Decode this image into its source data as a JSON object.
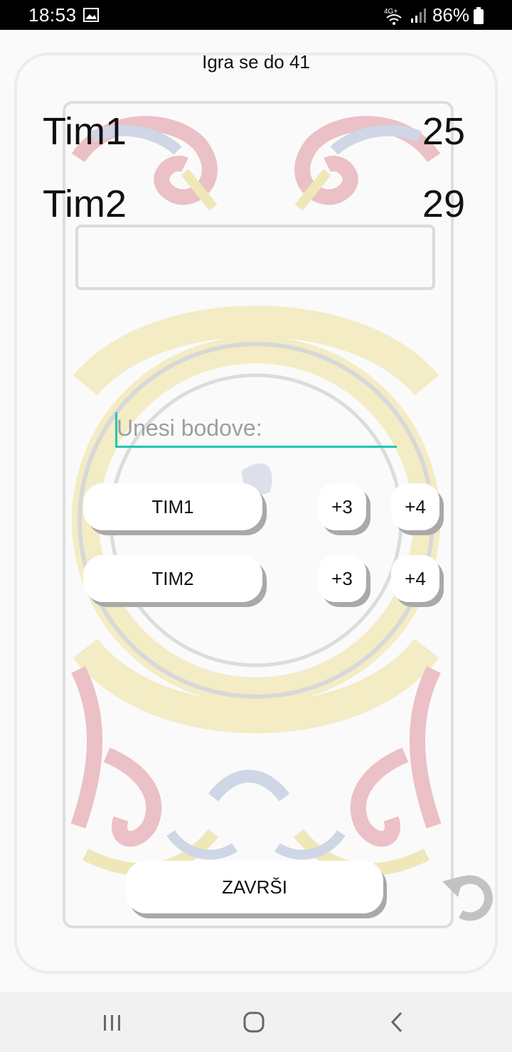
{
  "status_bar": {
    "time": "18:53",
    "network": "4G+",
    "battery": "86%",
    "icons": [
      "image-icon",
      "wifi-icon",
      "signal-icon",
      "battery-icon"
    ]
  },
  "game": {
    "goal_text": "Igra se do 41"
  },
  "teams": [
    {
      "name": "Tim1",
      "score": "25"
    },
    {
      "name": "Tim2",
      "score": "29"
    }
  ],
  "input": {
    "placeholder": "Unesi bodove:",
    "value": ""
  },
  "buttons": {
    "tim1": "TIM1",
    "tim2": "TIM2",
    "plus3": "+3",
    "plus4": "+4",
    "finish": "ZAVRŠI"
  },
  "colors": {
    "accent": "#22c4b4",
    "ornament_red": "#e9b6bd",
    "ornament_yellow": "#f2eab9",
    "ornament_blue": "#c9d2e2"
  },
  "icons": {
    "undo": "undo-icon",
    "nav": [
      "recent-apps-icon",
      "home-icon",
      "back-icon"
    ]
  }
}
